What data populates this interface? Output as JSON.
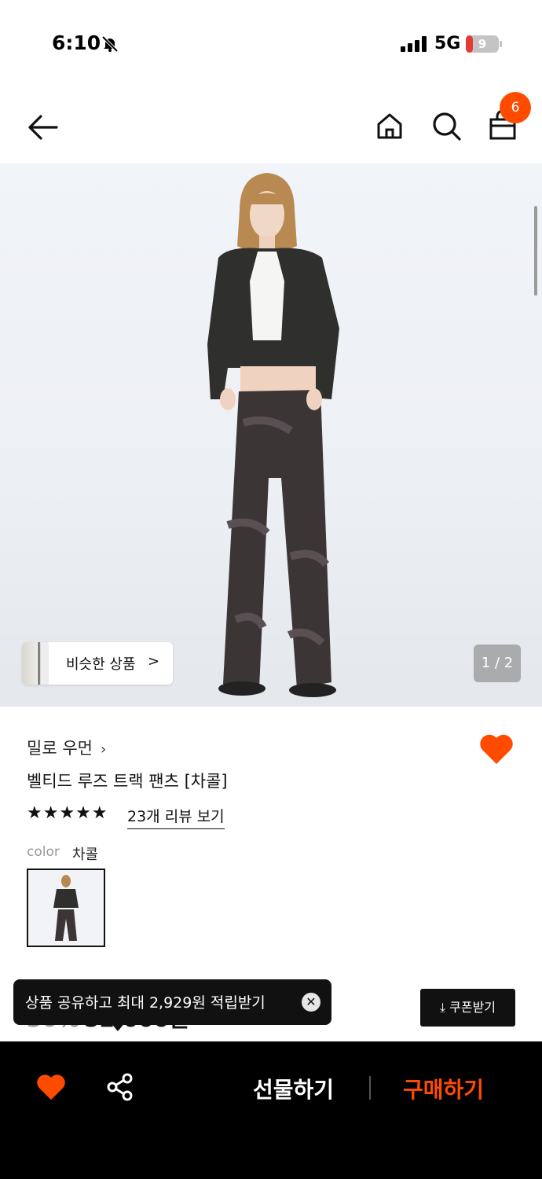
{
  "status_bar": {
    "time": "6:10",
    "network": "5G",
    "battery": "9"
  },
  "nav": {
    "cart_count": "6"
  },
  "hero": {
    "similar_label": "비슷한 상품",
    "pager": "1 / 2"
  },
  "product": {
    "brand": "밀로 우먼",
    "title": "벨티드 루즈 트랙 팬츠 [차콜]",
    "stars": "★★★★★",
    "rating": 5,
    "review_link": "23개 리뷰 보기",
    "option_label": "color",
    "option_value": "차콜",
    "price_discount": "30%",
    "price": "52,000원"
  },
  "toast": {
    "text": "상품 공유하고 최대 2,929원 적립받기",
    "close": "✕"
  },
  "coupon": {
    "label": "⤓ 쿠폰받기"
  },
  "bottom_bar": {
    "gift_label": "선물하기",
    "buy_label": "구매하기"
  },
  "colors": {
    "accent": "#ff4b00",
    "dark": "#000000"
  },
  "icons": [
    "bell-off-icon",
    "signal-icon",
    "battery-icon",
    "back-arrow-icon",
    "home-icon",
    "search-icon",
    "shopping-bag-icon",
    "heart-icon",
    "share-icon",
    "close-icon",
    "download-icon",
    "chevron-right-icon"
  ]
}
